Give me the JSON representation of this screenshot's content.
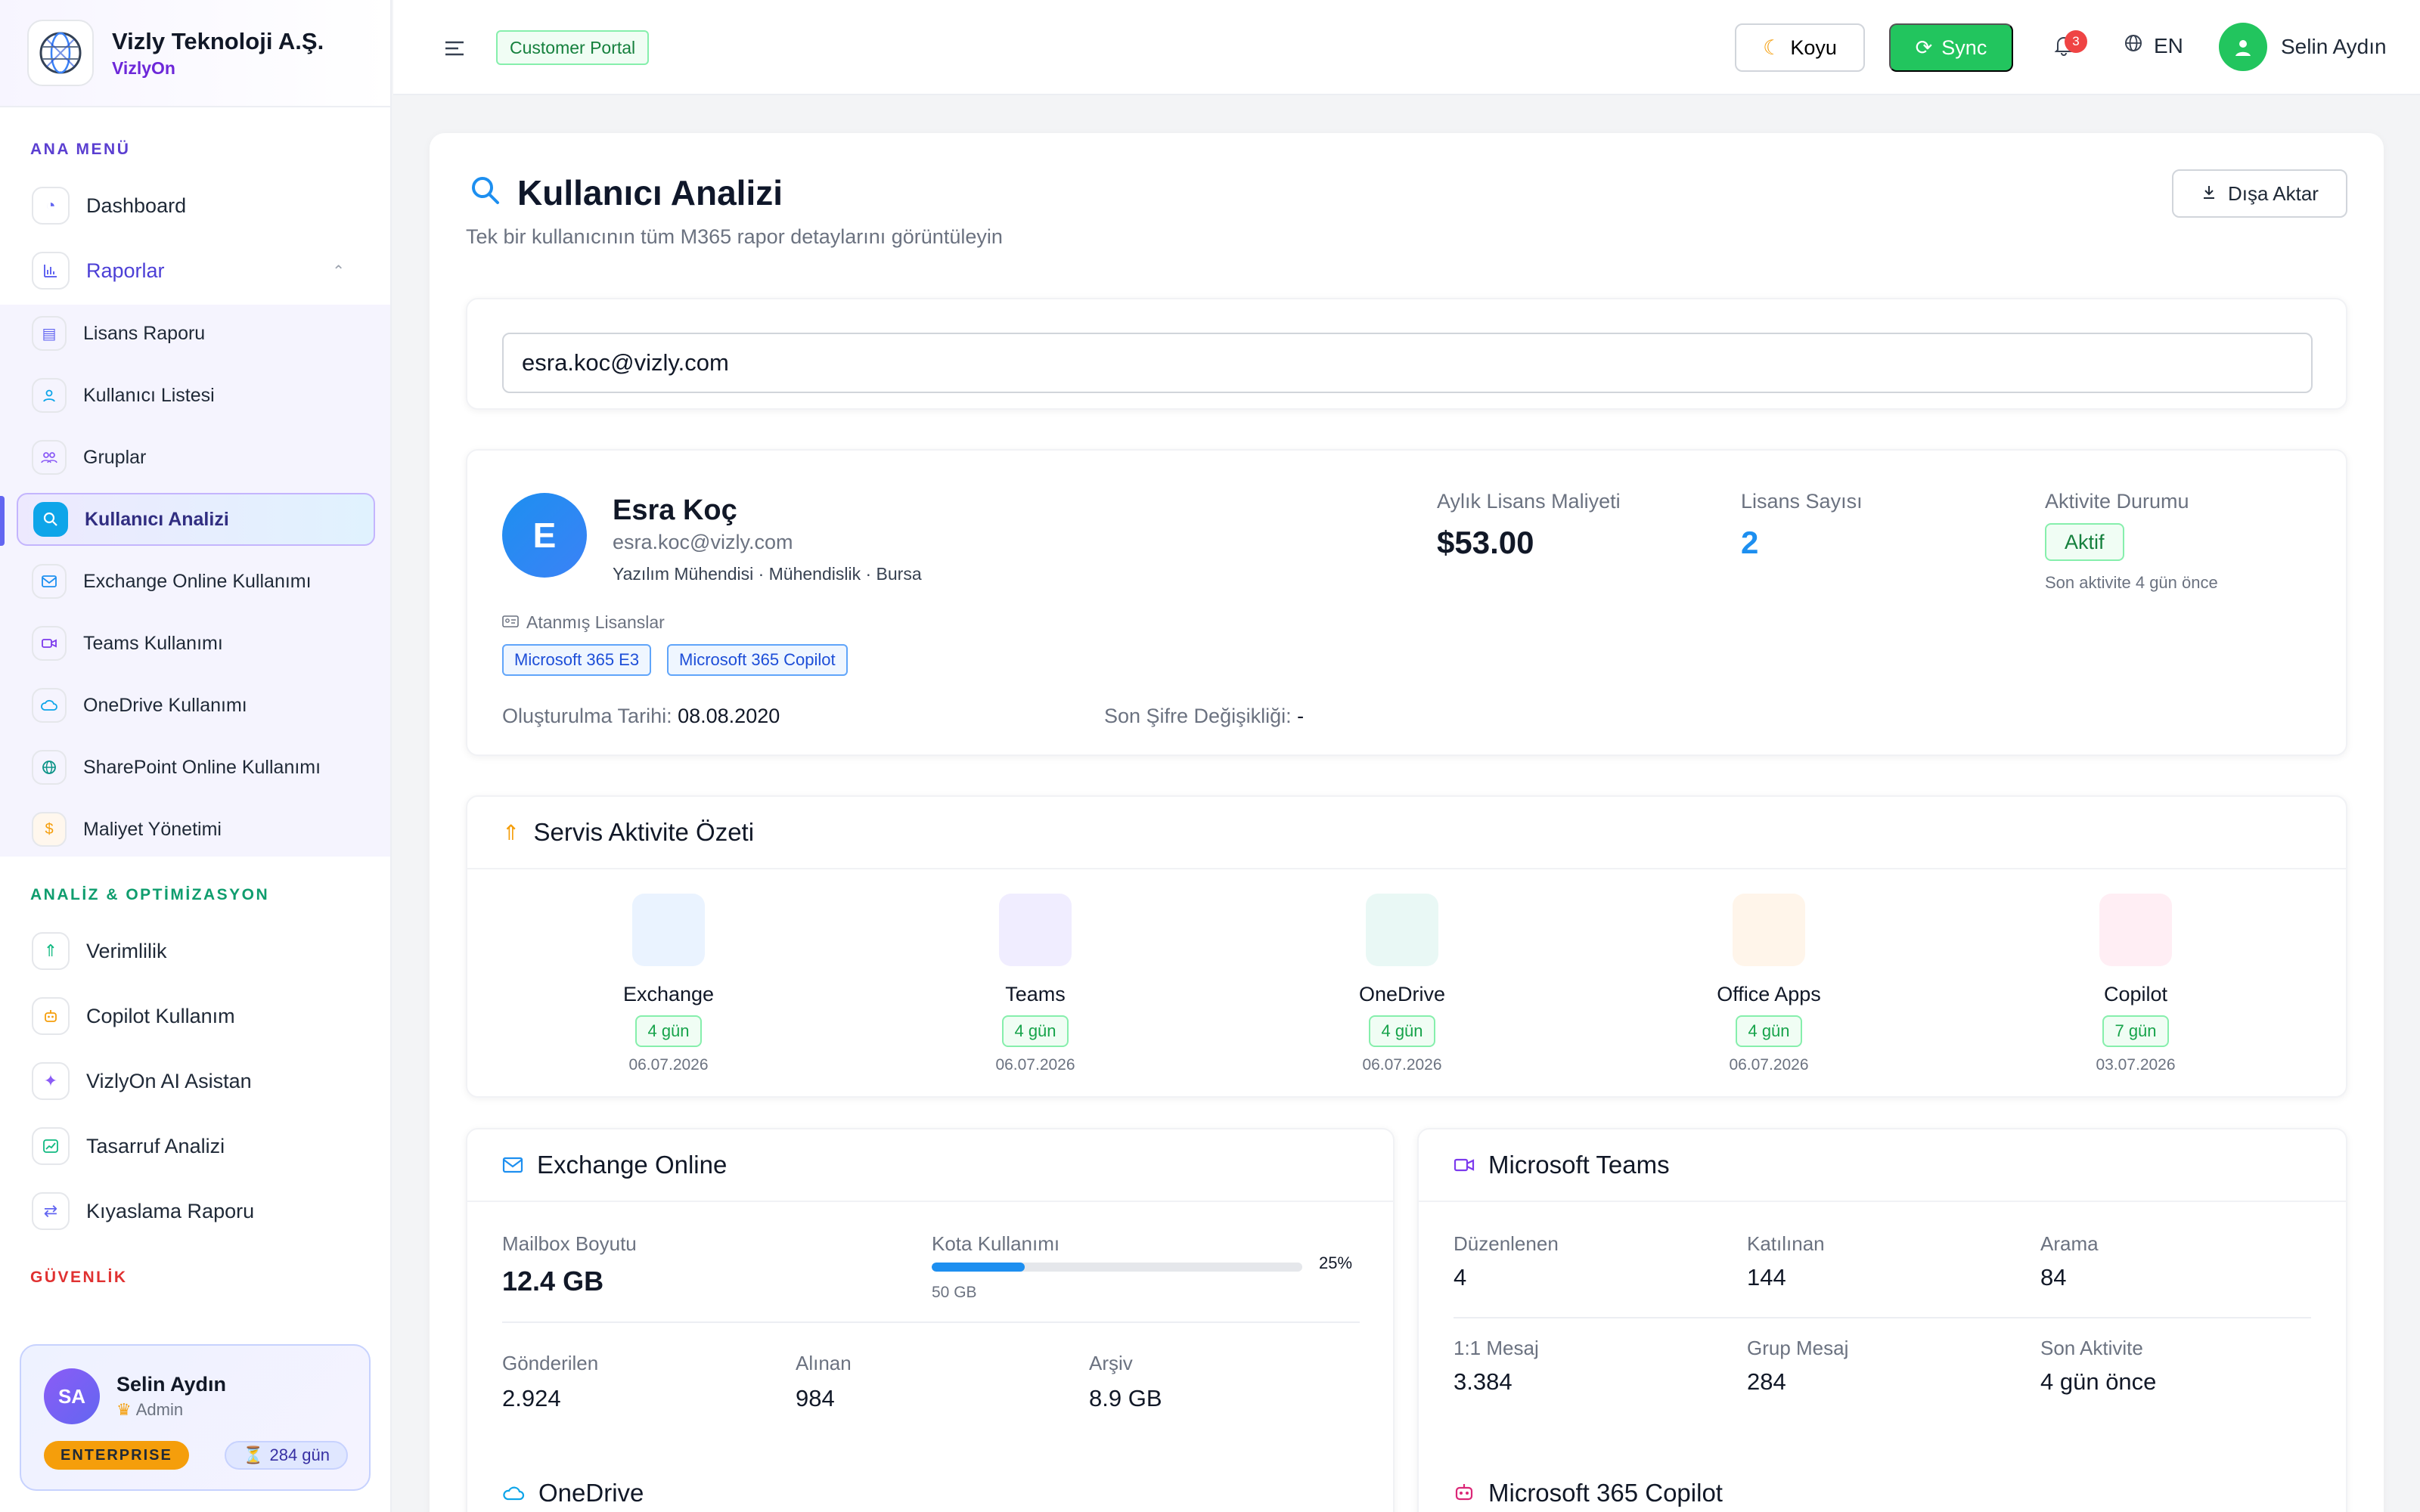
{
  "brand": {
    "name": "Vizly Teknoloji A.Ş.",
    "sub": "VizlyOn"
  },
  "sidebar": {
    "section_main": "ANA MENÜ",
    "section_analysis": "ANALİZ & OPTİMİZASYON",
    "section_security": "GÜVENLİK",
    "items": [
      {
        "label": "Dashboard",
        "icon": "dashboard-icon"
      },
      {
        "label": "Raporlar",
        "icon": "chart-icon"
      },
      {
        "label": "Lisans Raporu",
        "icon": "id-card-icon"
      },
      {
        "label": "Kullanıcı Listesi",
        "icon": "user-icon"
      },
      {
        "label": "Gruplar",
        "icon": "group-icon"
      },
      {
        "label": "Kullanıcı Analizi",
        "icon": "search-icon"
      },
      {
        "label": "Exchange Online Kullanımı",
        "icon": "mail-icon"
      },
      {
        "label": "Teams Kullanımı",
        "icon": "video-icon"
      },
      {
        "label": "OneDrive Kullanımı",
        "icon": "cloud-icon"
      },
      {
        "label": "SharePoint Online Kullanımı",
        "icon": "globe-icon"
      },
      {
        "label": "Maliyet Yönetimi",
        "icon": "dollar-icon"
      },
      {
        "label": "Verimlilik",
        "icon": "rocket-icon"
      },
      {
        "label": "Copilot Kullanım",
        "icon": "robot-icon"
      },
      {
        "label": "VizlyOn AI Asistan",
        "icon": "sparkle-icon"
      },
      {
        "label": "Tasarruf Analizi",
        "icon": "trend-icon"
      },
      {
        "label": "Kıyaslama Raporu",
        "icon": "swap-icon"
      }
    ],
    "user": {
      "initials": "SA",
      "name": "Selin Aydın",
      "role": "Admin",
      "plan": "ENTERPRISE",
      "days": "284 gün"
    }
  },
  "topbar": {
    "portal_tag": "Customer Portal",
    "theme_label": "Koyu",
    "sync_label": "Sync",
    "notif_count": "3",
    "lang": "EN",
    "user_name": "Selin Aydın"
  },
  "page": {
    "title": "Kullanıcı Analizi",
    "subtitle": "Tek bir kullanıcının tüm M365 rapor detaylarını görüntüleyin",
    "export_label": "Dışa Aktar",
    "search_value": "esra.koc@vizly.com"
  },
  "user": {
    "initial": "E",
    "name": "Esra Koç",
    "email": "esra.koc@vizly.com",
    "meta": "Yazılım Mühendisi · Mühendislik · Bursa",
    "licenses_label": "Atanmış Lisanslar",
    "licenses": [
      "Microsoft 365 E3",
      "Microsoft 365 Copilot"
    ],
    "created_label": "Oluşturulma Tarihi:",
    "created_value": "08.08.2020",
    "pwd_label": "Son Şifre Değişikliği:",
    "pwd_value": "-",
    "cost_label": "Aylık Lisans Maliyeti",
    "cost_value": "$53.00",
    "count_label": "Lisans Sayısı",
    "count_value": "2",
    "activity_label": "Aktivite Durumu",
    "activity_value": "Aktif",
    "last_activity": "Son aktivite 4 gün önce"
  },
  "services": {
    "title": "Servis Aktivite Özeti",
    "items": [
      {
        "name": "Exchange",
        "days": "4 gün",
        "date": "06.07.2026",
        "color": "#eaf3ff"
      },
      {
        "name": "Teams",
        "days": "4 gün",
        "date": "06.07.2026",
        "color": "#f0edff"
      },
      {
        "name": "OneDrive",
        "days": "4 gün",
        "date": "06.07.2026",
        "color": "#e9f8f5"
      },
      {
        "name": "Office Apps",
        "days": "4 gün",
        "date": "06.07.2026",
        "color": "#fff5ea"
      },
      {
        "name": "Copilot",
        "days": "7 gün",
        "date": "03.07.2026",
        "color": "#ffeef4"
      }
    ]
  },
  "exchange": {
    "title": "Exchange Online",
    "mailbox_label": "Mailbox Boyutu",
    "mailbox_value": "12.4 GB",
    "quota_label": "Kota Kullanımı",
    "quota_pct": 25,
    "quota_pct_text": "25%",
    "quota_total": "50 GB",
    "sent_label": "Gönderilen",
    "sent_value": "2.924",
    "recv_label": "Alınan",
    "recv_value": "984",
    "archive_label": "Arşiv",
    "archive_value": "8.9 GB"
  },
  "teams": {
    "title": "Microsoft Teams",
    "organized_label": "Düzenlenen",
    "organized_value": "4",
    "joined_label": "Katılınan",
    "joined_value": "144",
    "call_label": "Arama",
    "call_value": "84",
    "dm_label": "1:1 Mesaj",
    "dm_value": "3.384",
    "group_label": "Grup Mesaj",
    "group_value": "284",
    "last_label": "Son Aktivite",
    "last_value": "4 gün önce"
  },
  "bottom": {
    "onedrive_title": "OneDrive",
    "copilot_title": "Microsoft 365 Copilot"
  },
  "colors": {
    "primary": "#1d8ff0",
    "accent": "#6d28d9",
    "success": "#22c55e"
  }
}
